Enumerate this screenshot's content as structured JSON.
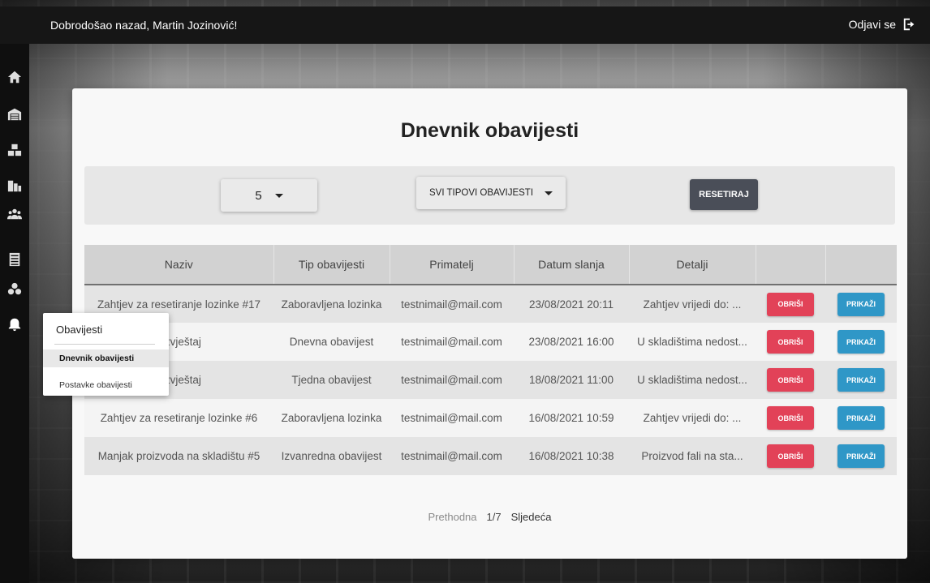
{
  "header": {
    "welcome": "Dobrodošao nazad, Martin Jozinović!",
    "logout_label": "Odjavi se"
  },
  "sidebar": {
    "icons": [
      "home-icon",
      "warehouse-icon",
      "boxes-icon",
      "buildings-icon",
      "users-icon",
      "list-icon",
      "products-icon",
      "bell-icon"
    ]
  },
  "page": {
    "title": "Dnevnik obavijesti"
  },
  "filters": {
    "count_value": "5",
    "type_value": "SVI TIPOVI OBAVIJESTI",
    "reset_label": "RESETIRAJ"
  },
  "table": {
    "columns": [
      "Naziv",
      "Tip obavijesti",
      "Primatelj",
      "Datum slanja",
      "Detalji",
      "",
      ""
    ],
    "rows": [
      {
        "naziv": "Zahtjev za resetiranje lozinke #17",
        "tip": "Zaboravljena lozinka",
        "primatelj": "testnimail@mail.com",
        "datum": "23/08/2021 20:11",
        "detalji": "Zahtjev vrijedi do: ..."
      },
      {
        "naziv": "i izvještaj",
        "tip": "Dnevna obavijest",
        "primatelj": "testnimail@mail.com",
        "datum": "23/08/2021 16:00",
        "detalji": "U skladištima nedost..."
      },
      {
        "naziv": "i izvještaj",
        "tip": "Tjedna obavijest",
        "primatelj": "testnimail@mail.com",
        "datum": "18/08/2021 11:00",
        "detalji": "U skladištima nedost..."
      },
      {
        "naziv": "Zahtjev za resetiranje lozinke #6",
        "tip": "Zaboravljena lozinka",
        "primatelj": "testnimail@mail.com",
        "datum": "16/08/2021 10:59",
        "detalji": "Zahtjev vrijedi do: ..."
      },
      {
        "naziv": "Manjak proizvoda na skladištu #5",
        "tip": "Izvanredna obavijest",
        "primatelj": "testnimail@mail.com",
        "datum": "16/08/2021 10:38",
        "detalji": "Proizvod fali na sta..."
      }
    ],
    "delete_label": "OBRIŠI",
    "show_label": "PRIKAŽI"
  },
  "pagination": {
    "prev": "Prethodna",
    "current": "1/7",
    "next": "Sljedeća"
  },
  "dropdown": {
    "title": "Obavijesti",
    "items": [
      "Dnevnik obavijesti",
      "Postavke obavijesti"
    ]
  },
  "colors": {
    "delete": "#e24258",
    "show": "#2f97c7",
    "reset": "#4a4e58"
  }
}
